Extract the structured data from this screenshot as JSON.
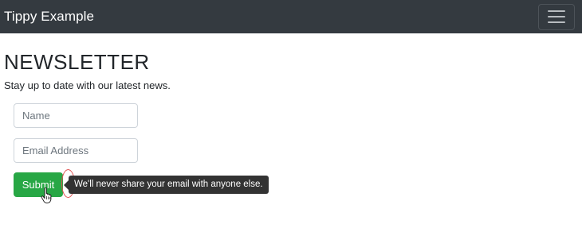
{
  "navbar": {
    "brand": "Tippy Example",
    "toggler_icon": "hamburger-menu-icon"
  },
  "content": {
    "title": "NEWSLETTER",
    "subtitle": "Stay up to date with our latest news."
  },
  "form": {
    "name_placeholder": "Name",
    "email_placeholder": "Email Address",
    "submit_label": "Submit"
  },
  "tooltip": {
    "text": "We'll never share your email with anyone else."
  },
  "colors": {
    "navbar_bg": "#343a40",
    "submit_bg": "#28a745",
    "tooltip_bg": "#333333",
    "highlight_ring": "#e05050"
  },
  "cursor_icon": "hand-pointer-icon"
}
